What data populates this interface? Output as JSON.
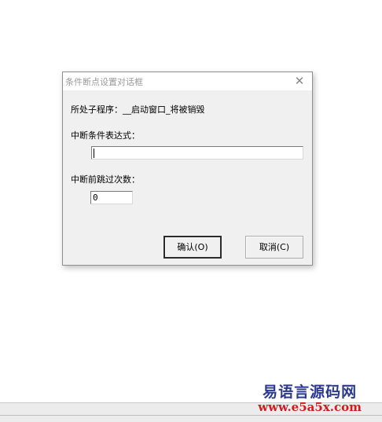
{
  "dialog": {
    "title": "条件断点设置对话框",
    "close_glyph": "✕",
    "location_label": "所处子程序：__启动窗口_将被销毁",
    "condition_label": "中断条件表达式：",
    "condition_value": "",
    "skip_label": "中断前跳过次数：",
    "skip_value": "0",
    "ok_label": "确认(O)",
    "cancel_label": "取消(C)"
  },
  "watermark": {
    "name": "易语言源码网",
    "url": "www.e5a5x.com"
  },
  "colors": {
    "dialog_bg": "#f0f0f0",
    "title_text": "#9a9a9a",
    "watermark_blue": "#2c3a8f",
    "watermark_red": "#d01c1c"
  }
}
